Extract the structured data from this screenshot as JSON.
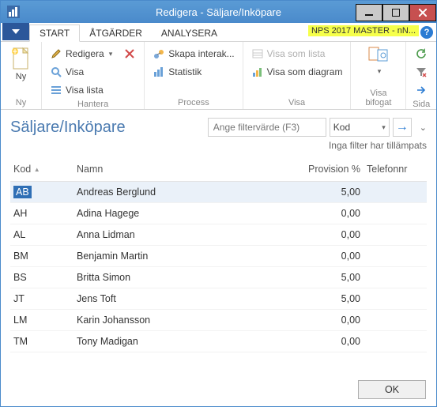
{
  "window": {
    "title": "Redigera - Säljare/Inköpare"
  },
  "env_tag": "NPS 2017 MASTER - nN...",
  "tabs": {
    "start": "START",
    "actions": "ÅTGÄRDER",
    "analyze": "ANALYSERA"
  },
  "ribbon": {
    "new_big": "Ny",
    "edit": "Redigera",
    "view": "Visa",
    "view_list": "Visa lista",
    "delete_icon": "✕",
    "create_interaction": "Skapa interak...",
    "statistics": "Statistik",
    "show_as_list": "Visa som lista",
    "show_as_diagram": "Visa som diagram",
    "groups": {
      "new": "Ny",
      "manage": "Hantera",
      "process": "Process",
      "show": "Visa",
      "show_attached": "Visa bifogat",
      "page": "Sida"
    }
  },
  "page": {
    "title": "Säljare/Inköpare",
    "filter_placeholder": "Ange filtervärde (F3)",
    "filter_field": "Kod",
    "filter_note": "Inga filter har tillämpats"
  },
  "columns": {
    "kod": "Kod",
    "namn": "Namn",
    "provision": "Provision %",
    "telefon": "Telefonnr"
  },
  "rows": [
    {
      "kod": "AB",
      "namn": "Andreas Berglund",
      "prov": "5,00",
      "tel": ""
    },
    {
      "kod": "AH",
      "namn": "Adina Hagege",
      "prov": "0,00",
      "tel": ""
    },
    {
      "kod": "AL",
      "namn": "Anna Lidman",
      "prov": "0,00",
      "tel": ""
    },
    {
      "kod": "BM",
      "namn": "Benjamin Martin",
      "prov": "0,00",
      "tel": ""
    },
    {
      "kod": "BS",
      "namn": "Britta Simon",
      "prov": "5,00",
      "tel": ""
    },
    {
      "kod": "JT",
      "namn": "Jens Toft",
      "prov": "5,00",
      "tel": ""
    },
    {
      "kod": "LM",
      "namn": "Karin Johansson",
      "prov": "0,00",
      "tel": ""
    },
    {
      "kod": "TM",
      "namn": "Tony Madigan",
      "prov": "0,00",
      "tel": ""
    }
  ],
  "footer": {
    "ok": "OK"
  }
}
